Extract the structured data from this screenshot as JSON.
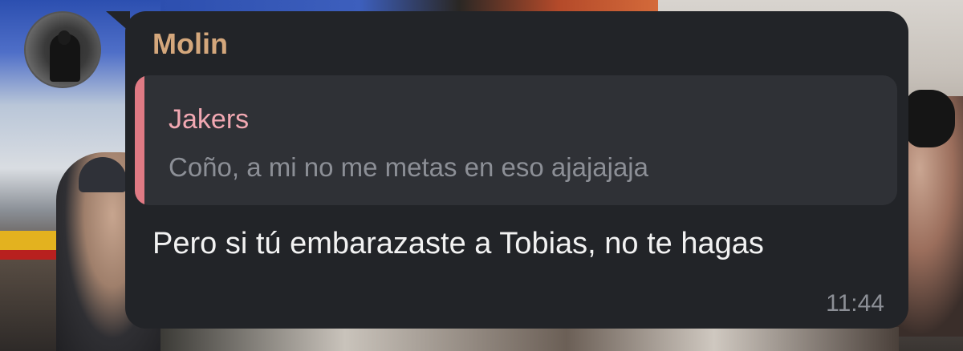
{
  "message": {
    "sender_name": "Molin",
    "reply": {
      "author": "Jakers",
      "text": "Coño, a mi no me metas en eso ajajajaja"
    },
    "text": "Pero si tú embarazaste a Tobias, no te hagas",
    "time": "11:44"
  },
  "colors": {
    "bubble_bg": "#222428",
    "sender_name": "#d4a77c",
    "reply_bg": "#2f3136",
    "reply_accent": "#e07a84",
    "reply_author": "#f1a8b2",
    "muted_text": "#8c8f96",
    "message_text": "#f2f2f2"
  },
  "icons": {
    "avatar": "user-avatar-photo"
  }
}
